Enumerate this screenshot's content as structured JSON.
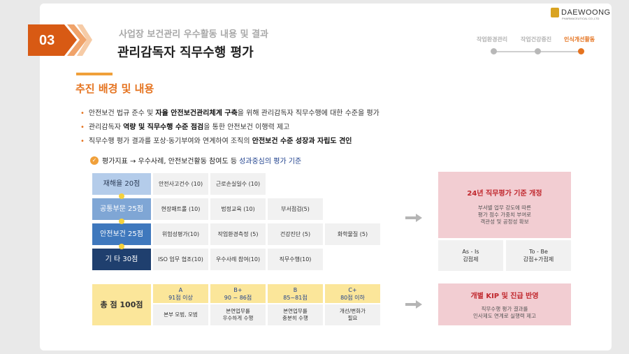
{
  "header": {
    "number": "03",
    "subtitle": "사업장 보건관리 우수활동 내용 및 결과",
    "title": "관리감독자 직무수행 평가",
    "logo_name": "DAEWOONG",
    "logo_sub": "PHARMACEUTICAL CO.,LTD",
    "steps": [
      "작업환경관리",
      "작업건강증진",
      "인식개선활동"
    ],
    "active_step": 2
  },
  "section": {
    "title": "추진 배경 및 내용",
    "bullets": [
      {
        "pre": "안전보건 법규 준수 및 ",
        "bold": "자율 안전보건관리체계 구축",
        "post": "을 위해 관리감독자 직무수행에 대한 수준을 평가"
      },
      {
        "pre": "관리감독자 ",
        "bold": "역량 및 직무수행 수준 점검",
        "post": "을 통한 안전보건 이행력 제고"
      },
      {
        "pre": "직무수행 평가 결과를 포상·동기부여와 연계하여 조직의 ",
        "bold": "안전보건 수준 성장과 자립도 견인",
        "post": ""
      }
    ],
    "indicator": {
      "pre": "평가지표 → 우수사례, 안전보건활동 참여도 등",
      "highlight": "성과중심의 평가 기준"
    }
  },
  "grid": {
    "rows": [
      {
        "label": "재해율   20점",
        "items": [
          "안전사고건수 (10)",
          "근로손실일수 (10)"
        ]
      },
      {
        "label": "공통부문 25점",
        "items": [
          "현장패트롤 (10)",
          "법정교육 (10)",
          "부서점검(5)"
        ]
      },
      {
        "label": "안전보건 25점",
        "items": [
          "위험성평가(10)",
          "작업환경측정 (5)",
          "건강진단 (5)",
          "화학물질 (5)"
        ]
      },
      {
        "label": "기  타   30점",
        "items": [
          "ISO 업무 협조(10)",
          "우수사례 참여(10)",
          "직무수행(10)"
        ]
      }
    ]
  },
  "grade": {
    "total": "총  점 100점",
    "headers": [
      {
        "grade": "A",
        "range": "91점 이상"
      },
      {
        "grade": "B+",
        "range": "90 ~ 86점"
      },
      {
        "grade": "B",
        "range": "85~81점"
      },
      {
        "grade": "C+",
        "range": "80점 이하"
      }
    ],
    "descs": [
      "본부 모범, 모범",
      "본연업무를\n우수하게 수행",
      "본연업무를\n충분히 수행",
      "개선/변화가\n필요"
    ]
  },
  "panel1": {
    "title": "24년 직무평가 기준 개정",
    "body": "부서별 업무 강도에 따른\n평가 점수 가중치 부여로\n객관성 및 공정성 확보",
    "left": "As - Is\n감점제",
    "right": "To - Be\n감점+가점제"
  },
  "panel2": {
    "title": "개별 KIP 및 진급 반영",
    "body": "직무수행 평가 결과를\n인사제도 연계로 실행력 제고"
  },
  "colors": {
    "accent": "#e5731f",
    "navy": "#1f3f6e",
    "pink": "#f2cdd2",
    "gold": "#fbe69a"
  }
}
